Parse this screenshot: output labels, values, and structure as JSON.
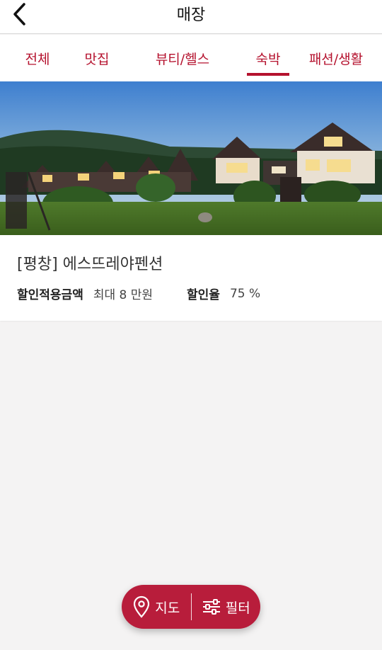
{
  "header": {
    "title": "매장",
    "back_icon": "chevron-left-icon"
  },
  "tabs": [
    {
      "label": "전체",
      "active": false
    },
    {
      "label": "맛집",
      "active": false
    },
    {
      "label": "뷰티/헬스",
      "active": false
    },
    {
      "label": "숙박",
      "active": true
    },
    {
      "label": "패션/생활",
      "active": false
    }
  ],
  "store": {
    "title": "[평창] 에스뜨레야펜션",
    "discount_amount_label": "할인적용금액",
    "discount_amount_value": "최대 8 만원",
    "discount_rate_label": "할인율",
    "discount_rate_value": "75 %"
  },
  "fab": {
    "map_label": "지도",
    "map_icon": "map-pin-icon",
    "filter_label": "필터",
    "filter_icon": "sliders-icon"
  },
  "colors": {
    "accent": "#b5122e",
    "fab_bg": "#b81d3b",
    "page_bg": "#f4f3f3"
  }
}
